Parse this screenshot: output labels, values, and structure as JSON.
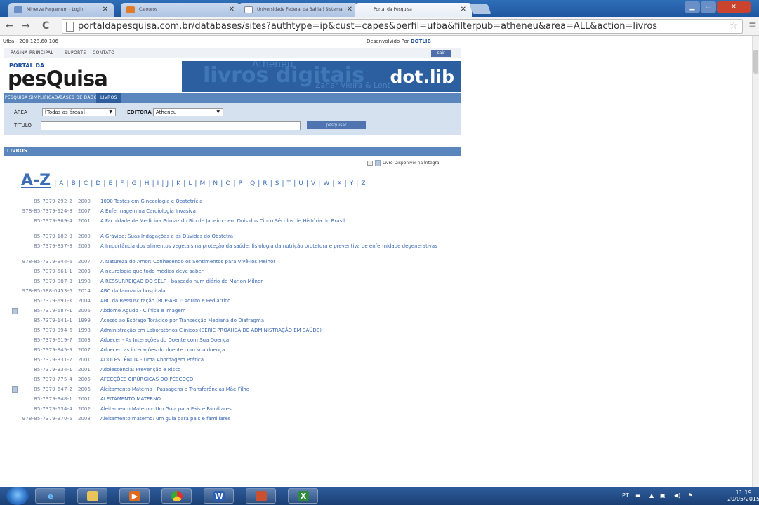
{
  "browser": {
    "tabs": [
      {
        "label": "Minerva Pergamum - Login"
      },
      {
        "label": "Calouros"
      },
      {
        "label": "Universidade Federal da Bahia | Sistema"
      },
      {
        "label": "Portal da Pesquisa"
      }
    ],
    "url": "portaldapesquisa.com.br/databases/sites?authtype=ip&cust=capes&perfil=ufba&filterpub=atheneu&area=ALL&action=livros"
  },
  "header": {
    "ip_line": "Ufba - 200.128.60.106",
    "developed_by_prefix": "Desenvolvido Por",
    "developed_by_brand": "DOTLIB",
    "menu": [
      "PÁGINA PRINCIPAL",
      "SUPORTE",
      "CONTATO"
    ],
    "sair_label": "sair"
  },
  "logo": {
    "small": "PORTAL DA",
    "big": "pesQuisa",
    "banner_ghost": "livros digitais",
    "banner_ghost2": "Atheneu",
    "banner_ghost3": "Zahar  Vieira & Lent",
    "banner_brand": "dot.lib"
  },
  "navbar": {
    "items": [
      "PESQUISA SIMPLIFICADA",
      "BASES DE DADOS",
      "LIVROS"
    ]
  },
  "search": {
    "area_label": "ÁREA",
    "area_value": "[Todas as áreas]",
    "editora_label": "EDITORA",
    "editora_value": "Atheneu",
    "titulo_label": "TÍTULO",
    "titulo_value": "",
    "button_label": "pesquisar"
  },
  "section": {
    "title": "LIVROS",
    "legend": "Livro Disponível na Íntegra",
    "az_title": "A-Z",
    "az_letters": "| A | B | C | D | E | F | G | H | I | J | K | L | M | N | O | P | Q | R | S | T | U | V | W | X | Y | Z"
  },
  "books": [
    {
      "isbn": "85-7379-292-2",
      "year": "2000",
      "title": "1000 Testes em Ginecologia e Obstetrícia",
      "icon": false
    },
    {
      "isbn": "978-85-7379-924-8",
      "year": "2007",
      "title": "A Enfermagem na Cardiologia Invasiva",
      "icon": false
    },
    {
      "isbn": "85-7379-369-4",
      "year": "2001",
      "title": "A Faculdade de Medicina Primaz do Rio de Janeiro - em Dois dos Cinco Séculos de História do Brasil",
      "icon": false
    },
    {
      "isbn": "85-7379-182-9",
      "year": "2000",
      "title": "A Grávida: Suas Indagações e as Dúvidas do Obstetra",
      "icon": false
    },
    {
      "isbn": "85-7379-837-8",
      "year": "2005",
      "title": "A Importância dos alimentos vegetais na proteção da saúde: fisiologia da nutrição protetora e preventiva de enfermidade degenerativas",
      "icon": false
    },
    {
      "isbn": "978-85-7379-944-6",
      "year": "2007",
      "title": "A Natureza do Amor: Conhecendo os Sentimentos para Vivê-los Melhor",
      "icon": false
    },
    {
      "isbn": "85-7379-561-1",
      "year": "2003",
      "title": "A neurologia que todo médico deve saber",
      "icon": false
    },
    {
      "isbn": "85-7379-087-3",
      "year": "1998",
      "title": "A RESSURREIÇÃO DO SELF - baseado num diário de Marion Milner",
      "icon": false
    },
    {
      "isbn": "978-85-388-0453-6",
      "year": "2014",
      "title": "ABC da farmácia hospitalar",
      "icon": false
    },
    {
      "isbn": "85-7379-691-X",
      "year": "2004",
      "title": "ABC da Ressuscitação (RCP-ABC): Adulto e Pediátrico",
      "icon": false
    },
    {
      "isbn": "85-7379-687-1",
      "year": "2006",
      "title": "Abdome Agudo - Clínica e Imagem",
      "icon": true
    },
    {
      "isbn": "85-7379-141-1",
      "year": "1999",
      "title": "Acesso ao Esôfago Torácico por Transecção Mediana do Diafragma",
      "icon": false
    },
    {
      "isbn": "85-7379-094-6",
      "year": "1998",
      "title": "Administração em Laboratórios Clínicos (SÉRIE PROAHSA DE ADMINISTRAÇÃO EM SAÚDE)",
      "icon": false
    },
    {
      "isbn": "85-7379-619-7",
      "year": "2003",
      "title": "Adoecer - As Interações do Doente com Sua Doença",
      "icon": false
    },
    {
      "isbn": "85-7379-845-9",
      "year": "2007",
      "title": "Adoecer: as interações do doente com sua doença",
      "icon": false
    },
    {
      "isbn": "85-7379-331-7",
      "year": "2001",
      "title": "ADOLESCÊNCIA - Uma Abordagem Prática",
      "icon": false
    },
    {
      "isbn": "85-7379-334-1",
      "year": "2001",
      "title": "Adolescência: Prevenção e Risco",
      "icon": false
    },
    {
      "isbn": "85-7379-775-4",
      "year": "2005",
      "title": "AFECÇÕES CIRÚRGICAS DO PESCOÇO",
      "icon": false
    },
    {
      "isbn": "85-7379-647-2",
      "year": "2006",
      "title": "Aleitamento Materno - Passagens e Transferências Mãe-Filho",
      "icon": true
    },
    {
      "isbn": "85-7379-348-1",
      "year": "2001",
      "title": "ALEITAMENTO MATERNO",
      "icon": false
    },
    {
      "isbn": "85-7379-534-4",
      "year": "2002",
      "title": "Aleitamento Materno: Um Guia para Pais e Familiares",
      "icon": false
    },
    {
      "isbn": "978-85-7379-970-5",
      "year": "2008",
      "title": "Aleitamento materno: um guia para pais e familiares",
      "icon": false
    }
  ],
  "taskbar": {
    "tray_lang": "PT",
    "time": "11:19",
    "date": "20/05/2015"
  }
}
